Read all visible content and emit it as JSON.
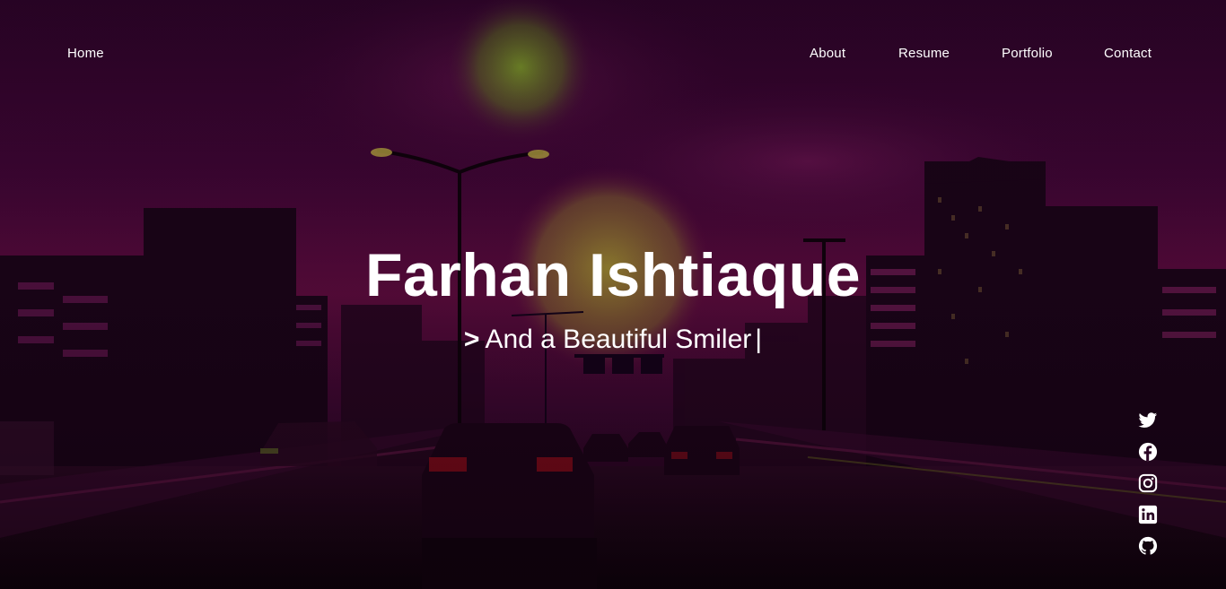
{
  "nav": {
    "home": "Home",
    "items": [
      "About",
      "Resume",
      "Portfolio",
      "Contact"
    ]
  },
  "hero": {
    "name": "Farhan Ishtiaque",
    "prompt": ">",
    "tagline": "And a Beautiful Smiler",
    "cursor": "|"
  },
  "social": {
    "icons": [
      "twitter-icon",
      "facebook-icon",
      "instagram-icon",
      "linkedin-icon",
      "github-icon"
    ]
  },
  "colors": {
    "text": "#ffffff",
    "sky_top": "#2a0424",
    "sky_mid": "#5a0a3a",
    "sun": "#8a7a2a",
    "moon": "#6a8a20"
  }
}
